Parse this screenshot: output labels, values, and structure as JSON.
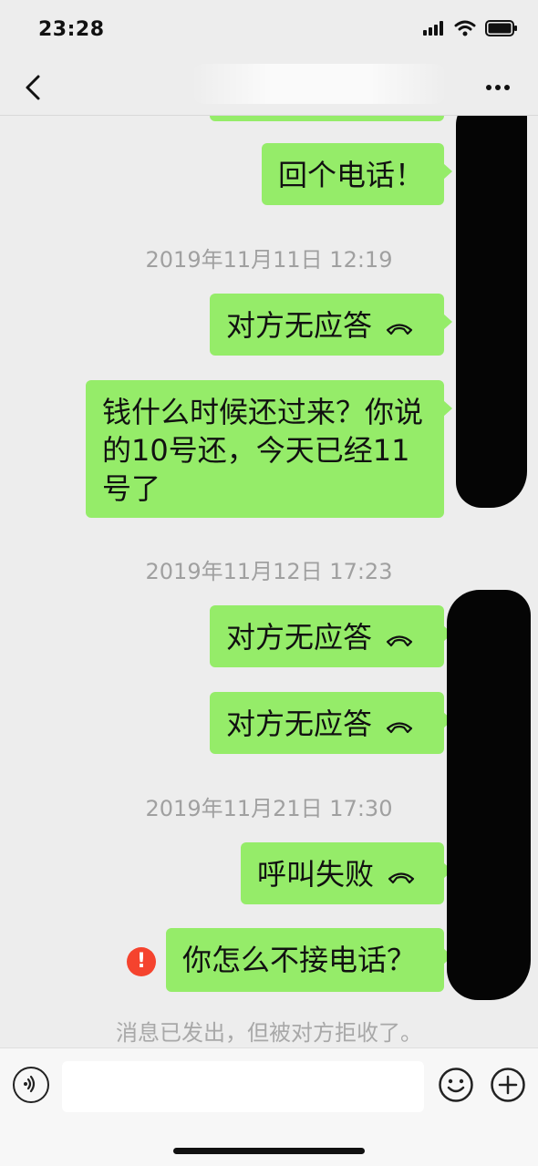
{
  "status_bar": {
    "time": "23:28",
    "icons": [
      "signal-icon",
      "wifi-icon",
      "battery-icon"
    ]
  },
  "nav": {
    "back_icon": "chevron-left-icon",
    "more_icon": "more-dots-icon"
  },
  "messages": [
    {
      "type": "text",
      "text": "回个电话！"
    },
    {
      "type": "timestamp",
      "text": "2019年11月11日 12:19"
    },
    {
      "type": "call",
      "text": "对方无应答",
      "icon": "phone-hangup-icon"
    },
    {
      "type": "text",
      "text": "钱什么时候还过来？你说的10号还，今天已经11号了"
    },
    {
      "type": "timestamp",
      "text": "2019年11月12日 17:23"
    },
    {
      "type": "call",
      "text": "对方无应答",
      "icon": "phone-hangup-icon"
    },
    {
      "type": "call",
      "text": "对方无应答",
      "icon": "phone-hangup-icon"
    },
    {
      "type": "timestamp",
      "text": "2019年11月21日 17:30"
    },
    {
      "type": "call",
      "text": "呼叫失败",
      "icon": "phone-hangup-icon"
    },
    {
      "type": "text",
      "text": "你怎么不接电话？",
      "status": "failed",
      "error_icon_text": "!"
    }
  ],
  "system_note": "消息已发出，但被对方拒收了。",
  "input_bar": {
    "voice_icon": "voice-icon",
    "input_value": "",
    "emoji_icon": "emoji-icon",
    "plus_icon": "plus-icon"
  },
  "colors": {
    "background": "#ededed",
    "bubble_green": "#95ec69",
    "timestamp_gray": "#a0a0a0",
    "error_red": "#f5432e",
    "redaction": "#050505"
  }
}
